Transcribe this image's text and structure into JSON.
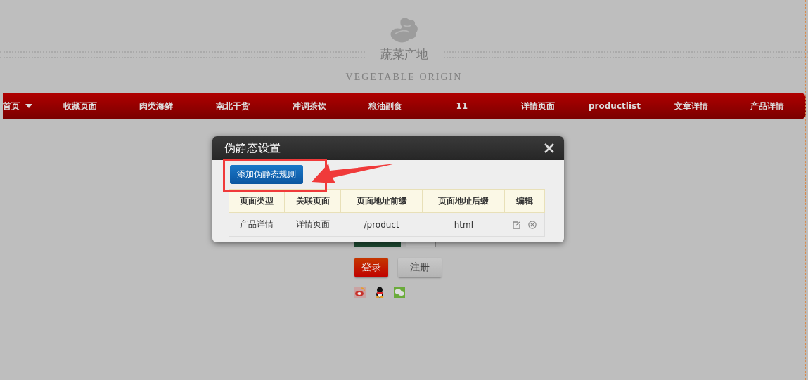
{
  "site": {
    "title": "蔬菜产地",
    "subtitle": "VEGETABLE ORIGIN"
  },
  "nav": [
    {
      "label": "首页",
      "dropdown": true
    },
    {
      "label": "收藏页面",
      "dropdown": false
    },
    {
      "label": "肉类海鲜",
      "dropdown": false
    },
    {
      "label": "南北干货",
      "dropdown": false
    },
    {
      "label": "冲调茶饮",
      "dropdown": false
    },
    {
      "label": "粮油副食",
      "dropdown": false
    },
    {
      "label": "11",
      "dropdown": false
    },
    {
      "label": "详情页面",
      "dropdown": false
    },
    {
      "label": "productlist",
      "dropdown": false
    },
    {
      "label": "文章详情",
      "dropdown": false
    },
    {
      "label": "产品详情",
      "dropdown": false
    }
  ],
  "login": {
    "buttons": [
      {
        "label": "登录",
        "kind": "primary"
      },
      {
        "label": "注册",
        "kind": "secondary"
      }
    ]
  },
  "dialog": {
    "title": "伪静态设置",
    "add_button": "添加伪静态规则",
    "table": {
      "columns": [
        "页面类型",
        "关联页面",
        "页面地址前缀",
        "页面地址后缀",
        "编辑"
      ],
      "rows": [
        {
          "page_type": "产品详情",
          "linked_page": "详情页面",
          "prefix": "/product",
          "suffix": "html"
        }
      ]
    }
  }
}
